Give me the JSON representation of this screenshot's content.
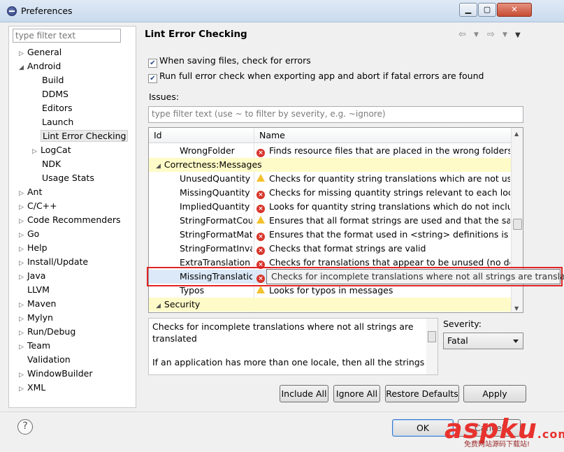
{
  "window": {
    "title": "Preferences"
  },
  "sidebar": {
    "filter_placeholder": "type filter text",
    "items": [
      {
        "label": "General"
      },
      {
        "label": "Android"
      },
      {
        "label": "Build"
      },
      {
        "label": "DDMS"
      },
      {
        "label": "Editors"
      },
      {
        "label": "Launch"
      },
      {
        "label": "Lint Error Checking"
      },
      {
        "label": "LogCat"
      },
      {
        "label": "NDK"
      },
      {
        "label": "Usage Stats"
      },
      {
        "label": "Ant"
      },
      {
        "label": "C/C++"
      },
      {
        "label": "Code Recommenders"
      },
      {
        "label": "Go"
      },
      {
        "label": "Help"
      },
      {
        "label": "Install/Update"
      },
      {
        "label": "Java"
      },
      {
        "label": "LLVM"
      },
      {
        "label": "Maven"
      },
      {
        "label": "Mylyn"
      },
      {
        "label": "Run/Debug"
      },
      {
        "label": "Team"
      },
      {
        "label": "Validation"
      },
      {
        "label": "WindowBuilder"
      },
      {
        "label": "XML"
      }
    ]
  },
  "page": {
    "title": "Lint Error Checking",
    "check_saving": "When saving files, check for errors",
    "check_export": "Run full error check when exporting app and abort if fatal errors are found",
    "issues_label": "Issues:",
    "issue_filter_placeholder": "type filter text (use ~ to filter by severity, e.g. ~ignore)"
  },
  "table": {
    "headers": {
      "id": "Id",
      "name": "Name"
    },
    "rows": [
      {
        "id": "WrongFolder",
        "name": "Finds resource files that are placed in the wrong folders",
        "icon": "error-icon"
      },
      {
        "category": "Correctness:Messages"
      },
      {
        "id": "UnusedQuantity",
        "name": "Checks for quantity string translations which are not used",
        "icon": "warning-icon"
      },
      {
        "id": "MissingQuantity",
        "name": "Checks for missing quantity strings relevant to each locale",
        "icon": "error-icon"
      },
      {
        "id": "ImpliedQuantity",
        "name": "Looks for quantity string translations which do not include",
        "icon": "error-icon"
      },
      {
        "id": "StringFormatCount",
        "name": "Ensures that all format strings are used and that the same",
        "icon": "warning-icon"
      },
      {
        "id": "StringFormatMatches",
        "name": "Ensures that the format used in <string> definitions is co",
        "icon": "error-icon"
      },
      {
        "id": "StringFormatInvalid",
        "name": "Checks that format strings are valid",
        "icon": "error-icon"
      },
      {
        "id": "ExtraTranslation",
        "name": "Checks for translations that appear to be unused (no def",
        "icon": "error-icon"
      },
      {
        "id": "MissingTranslation",
        "name": "",
        "icon": "error-icon"
      },
      {
        "id": "Typos",
        "name": "Looks for typos in messages",
        "icon": "warning-icon"
      },
      {
        "category": "Security"
      }
    ],
    "tooltip": "Checks for incomplete translations where not all strings are translated"
  },
  "description": {
    "line1": "Checks for incomplete translations where not all strings are",
    "line2": "translated",
    "line3": "If an application has more than one locale, then all the strings"
  },
  "severity": {
    "label": "Severity:",
    "value": "Fatal"
  },
  "buttons": {
    "include_all": "Include All",
    "ignore_all": "Ignore All",
    "restore_defaults": "Restore Defaults",
    "apply": "Apply",
    "ok": "OK",
    "cancel": "Cancel"
  },
  "watermark": {
    "brand": "aspku",
    "tld": ".com",
    "sub": "免费网站源码下载站!"
  },
  "colors": {
    "accent": "#3d7ac9",
    "highlight_border": "#e02424",
    "category_bg": "#fffbc8",
    "error": "#d8342a",
    "warning": "#f2c12e"
  }
}
